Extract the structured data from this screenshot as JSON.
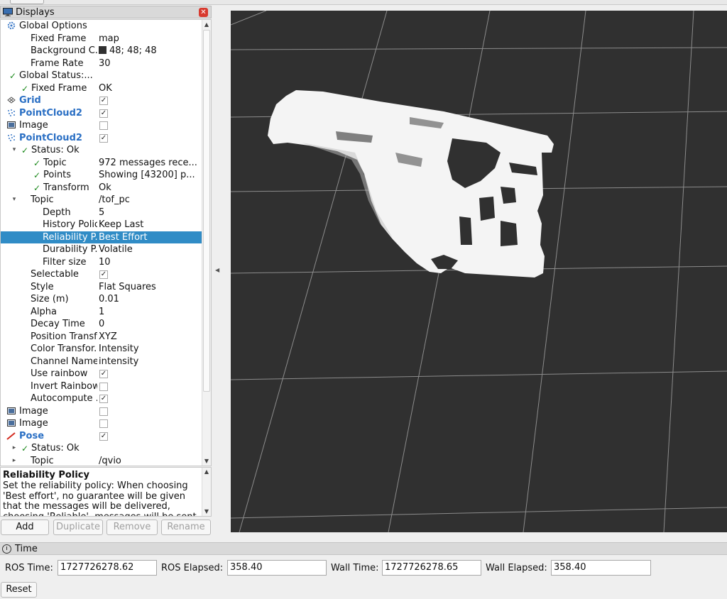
{
  "displays": {
    "title": "Displays",
    "tree": [
      {
        "name": "Global Options",
        "value": "",
        "indent": 0,
        "icon": "gear-icon",
        "kind": "plain"
      },
      {
        "name": "Fixed Frame",
        "value": "map",
        "indent": 1
      },
      {
        "name": "Background C...",
        "value": "48; 48; 48",
        "indent": 1,
        "swatch": "#303030"
      },
      {
        "name": "Frame Rate",
        "value": "30",
        "indent": 1
      },
      {
        "name": "Global Status:...",
        "value": "",
        "indent": 0,
        "icon": "check-icon"
      },
      {
        "name": "Fixed Frame",
        "value": "OK",
        "indent": 1,
        "icon": "check-icon"
      },
      {
        "name": "Grid",
        "value": "",
        "indent": 0,
        "icon": "grid-icon",
        "bold": true,
        "checkbox": true
      },
      {
        "name": "PointCloud2",
        "value": "",
        "indent": 0,
        "icon": "pointcloud-icon",
        "bold": true,
        "checkbox": true
      },
      {
        "name": "Image",
        "value": "",
        "indent": 0,
        "icon": "image-icon",
        "checkbox": false
      },
      {
        "name": "PointCloud2",
        "value": "",
        "indent": 0,
        "icon": "pointcloud-icon",
        "bold": true,
        "checkbox": true
      },
      {
        "name": "Status: Ok",
        "value": "",
        "indent": 1,
        "icon": "check-icon",
        "arrow": "down"
      },
      {
        "name": "Topic",
        "value": "972 messages rece...",
        "indent": 2,
        "icon": "check-icon"
      },
      {
        "name": "Points",
        "value": "Showing [43200] p...",
        "indent": 2,
        "icon": "check-icon"
      },
      {
        "name": "Transform",
        "value": "Ok",
        "indent": 2,
        "icon": "check-icon"
      },
      {
        "name": "Topic",
        "value": "/tof_pc",
        "indent": 1,
        "arrow": "down"
      },
      {
        "name": "Depth",
        "value": "5",
        "indent": 2
      },
      {
        "name": "History Policy",
        "value": "Keep Last",
        "indent": 2
      },
      {
        "name": "Reliability P...",
        "value": "Best Effort",
        "indent": 2,
        "selected": true
      },
      {
        "name": "Durability P...",
        "value": "Volatile",
        "indent": 2
      },
      {
        "name": "Filter size",
        "value": "10",
        "indent": 2
      },
      {
        "name": "Selectable",
        "value": "",
        "indent": 1,
        "checkbox": true
      },
      {
        "name": "Style",
        "value": "Flat Squares",
        "indent": 1
      },
      {
        "name": "Size (m)",
        "value": "0.01",
        "indent": 1
      },
      {
        "name": "Alpha",
        "value": "1",
        "indent": 1
      },
      {
        "name": "Decay Time",
        "value": "0",
        "indent": 1
      },
      {
        "name": "Position Transf...",
        "value": "XYZ",
        "indent": 1
      },
      {
        "name": "Color Transfor...",
        "value": "Intensity",
        "indent": 1
      },
      {
        "name": "Channel Name",
        "value": "intensity",
        "indent": 1
      },
      {
        "name": "Use rainbow",
        "value": "",
        "indent": 1,
        "checkbox": true
      },
      {
        "name": "Invert Rainbow",
        "value": "",
        "indent": 1,
        "checkbox": false
      },
      {
        "name": "Autocompute ...",
        "value": "",
        "indent": 1,
        "checkbox": true
      },
      {
        "name": "Image",
        "value": "",
        "indent": 0,
        "icon": "image-icon",
        "checkbox": false
      },
      {
        "name": "Image",
        "value": "",
        "indent": 0,
        "icon": "image-icon",
        "checkbox": false
      },
      {
        "name": "Pose",
        "value": "",
        "indent": 0,
        "icon": "pose-arrow-icon",
        "bold": true,
        "checkbox": true
      },
      {
        "name": "Status: Ok",
        "value": "",
        "indent": 1,
        "icon": "check-icon",
        "arrow": "right"
      },
      {
        "name": "Topic",
        "value": "/qvio",
        "indent": 1,
        "arrow": "right"
      }
    ],
    "description": {
      "title": "Reliability Policy",
      "body": "Set the reliability policy: When choosing 'Best effort', no guarantee will be given that the messages will be delivered, choosing 'Reliable', messages will be sent"
    },
    "buttons": {
      "add": "Add",
      "duplicate": "Duplicate",
      "remove": "Remove",
      "rename": "Rename"
    }
  },
  "time": {
    "title": "Time",
    "ros_time_label": "ROS Time:",
    "ros_time": "1727726278.62",
    "ros_elapsed_label": "ROS Elapsed:",
    "ros_elapsed": "358.40",
    "wall_time_label": "Wall Time:",
    "wall_time": "1727726278.65",
    "wall_elapsed_label": "Wall Elapsed:",
    "wall_elapsed": "358.40",
    "reset": "Reset"
  },
  "colors": {
    "selection": "#308cc6",
    "viewport_bg": "#303030",
    "check_green": "#1d8a1d",
    "display_blue": "#2a6fc4"
  }
}
